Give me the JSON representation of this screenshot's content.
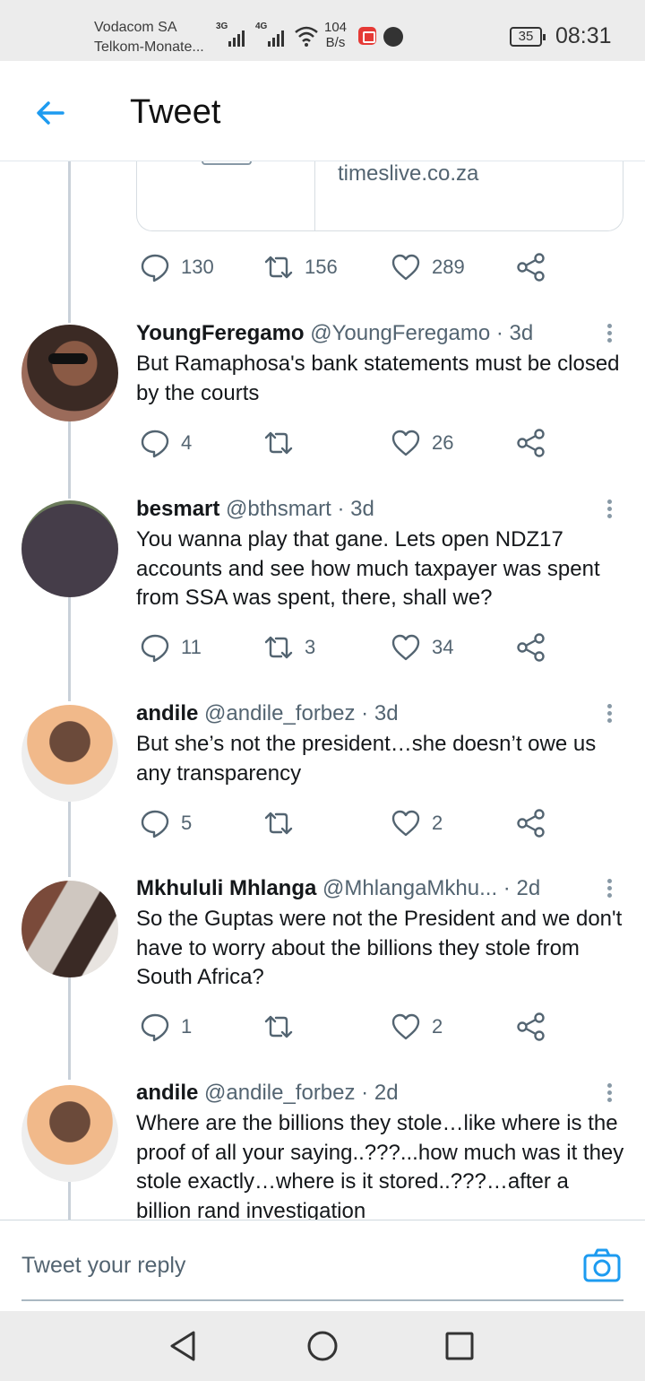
{
  "status_bar": {
    "carrier_1": "Vodacom SA",
    "carrier_2": "Telkom-Monate...",
    "net_1": "3G",
    "net_2": "4G",
    "speed_value": "104",
    "speed_unit": "B/s",
    "battery": "35",
    "time": "08:31"
  },
  "header": {
    "title": "Tweet"
  },
  "link_card": {
    "domain": "timeslive.co.za"
  },
  "main_tweet_actions": {
    "replies": "130",
    "retweets": "156",
    "likes": "289"
  },
  "replies": [
    {
      "name": "YoungFeregamo",
      "handle": "@YoungFeregamo",
      "time": "3d",
      "text": "But Ramaphosa's bank statements must be closed by the courts",
      "replies": "4",
      "retweets": "",
      "likes": "26"
    },
    {
      "name": "besmart",
      "handle": "@bthsmart",
      "time": "3d",
      "text": "You wanna play that gane. Lets open NDZ17 accounts and see how much taxpayer was spent from SSA was spent, there, shall we?",
      "replies": "11",
      "retweets": "3",
      "likes": "34"
    },
    {
      "name": "andile",
      "handle": "@andile_forbez",
      "time": "3d",
      "text": "But she’s not the president…she doesn’t owe us any transparency",
      "replies": "5",
      "retweets": "",
      "likes": "2"
    },
    {
      "name": "Mkhululi Mhlanga",
      "handle": "@MhlangaMkhu...",
      "time": "2d",
      "text": "So the Guptas were not the President and we don't have to worry about the billions they stole from South Africa?",
      "replies": "1",
      "retweets": "",
      "likes": "2"
    },
    {
      "name": "andile",
      "handle": "@andile_forbez",
      "time": "2d",
      "text": "Where are the billions they stole…like where is the proof of all your saying..???...how much was it they stole exactly…where is it stored..???…after a billion rand investigation",
      "replies": "",
      "retweets": "",
      "likes": ""
    }
  ],
  "reply_bar": {
    "placeholder": "Tweet your reply"
  },
  "colors": {
    "accent": "#1d9bf0",
    "muted": "#536471",
    "thread": "#c9d1d9"
  },
  "icons": [
    "back-arrow-icon",
    "reply-icon",
    "retweet-icon",
    "like-icon",
    "share-icon",
    "more-icon",
    "camera-icon",
    "nav-back-icon",
    "nav-home-icon",
    "nav-recents-icon"
  ]
}
